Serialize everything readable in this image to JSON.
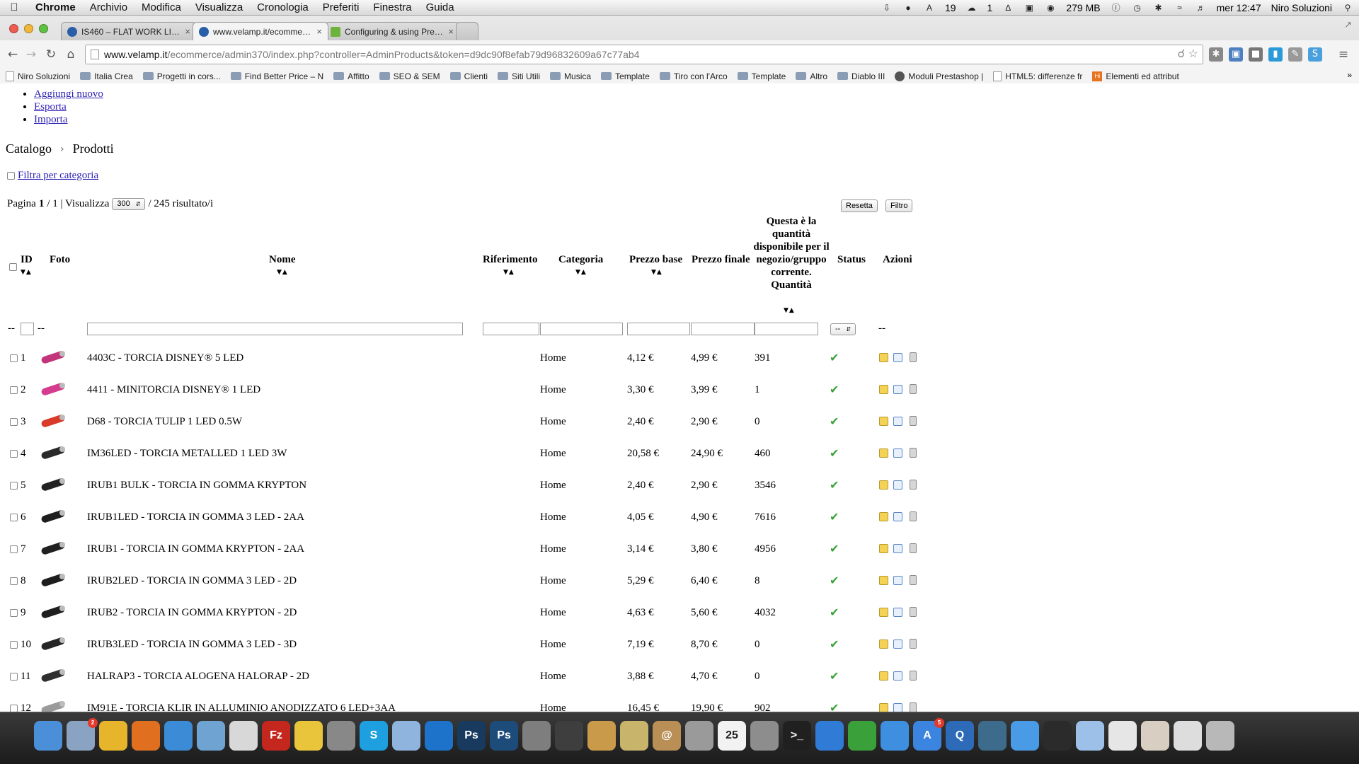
{
  "menubar": {
    "app_name": "Chrome",
    "menus": [
      "Archivio",
      "Modifica",
      "Visualizza",
      "Cronologia",
      "Preferiti",
      "Finestra",
      "Guida"
    ],
    "status": {
      "adobe_count": "19",
      "cloud_count": "1",
      "memory": "279 MB",
      "clock": "mer 12:47",
      "user": "Niro Soluzioni"
    }
  },
  "browser": {
    "tabs": [
      {
        "title": "IS460 – FLAT WORK LIGHT",
        "active": false
      },
      {
        "title": "www.velamp.it/ecommerce",
        "active": true
      },
      {
        "title": "Configuring & using Presta",
        "active": false
      }
    ],
    "url_host": "www.velamp.it",
    "url_path": "/ecommerce/admin370/index.php?controller=AdminProducts&token=d9dc90f8efab79d96832609a67c77ab4",
    "bookmarks": [
      {
        "label": "Niro Soluzioni",
        "icon": "page-icon"
      },
      {
        "label": "Italia Crea",
        "icon": "folder-icon"
      },
      {
        "label": "Progetti in cors...",
        "icon": "folder-icon"
      },
      {
        "label": "Find Better Price – N",
        "icon": "folder-icon"
      },
      {
        "label": "Affitto",
        "icon": "folder-icon"
      },
      {
        "label": "SEO & SEM",
        "icon": "folder-icon"
      },
      {
        "label": "Clienti",
        "icon": "folder-icon"
      },
      {
        "label": "Siti Utili",
        "icon": "folder-icon"
      },
      {
        "label": "Musica",
        "icon": "folder-icon"
      },
      {
        "label": "Template",
        "icon": "folder-icon"
      },
      {
        "label": "Tiro con l'Arco",
        "icon": "folder-icon"
      },
      {
        "label": "Template",
        "icon": "folder-icon"
      },
      {
        "label": "Altro",
        "icon": "folder-icon"
      },
      {
        "label": "Diablo III",
        "icon": "folder-icon"
      },
      {
        "label": "Moduli Prestashop |",
        "icon": "gear-icon"
      },
      {
        "label": "HTML5: differenze fr",
        "icon": "page-icon"
      },
      {
        "label": "Elementi ed attribut",
        "icon": "hm-icon"
      }
    ],
    "bookmarks_more": "»"
  },
  "page": {
    "actions": [
      "Aggiungi nuovo",
      "Esporta",
      "Importa"
    ],
    "breadcrumb": [
      "Catalogo",
      "Prodotti"
    ],
    "filter_category_label": "Filtra per categoria",
    "pagination": {
      "label": "Pagina",
      "current": "1",
      "total": "/ 1 | Visualizza",
      "per_page": "300",
      "results": "/ 245 risultato/i"
    },
    "buttons": {
      "reset": "Resetta",
      "filter": "Filtro"
    },
    "headers": {
      "id": "ID",
      "photo": "Foto",
      "name": "Nome",
      "reference": "Riferimento",
      "category": "Categoria",
      "base_price": "Prezzo base",
      "final_price": "Prezzo finale",
      "quantity": "Questa è la quantità disponibile per il negozio/gruppo corrente. Quantità",
      "status": "Status",
      "actions": "Azioni"
    },
    "filter_row": {
      "dash": "--",
      "status_select": "--"
    },
    "products": [
      {
        "id": "1",
        "name": "4403C - TORCIA DISNEY® 5 LED",
        "category": "Home",
        "base": "4,12 €",
        "final": "4,99 €",
        "qty": "391",
        "thumb_color": "#c2357a"
      },
      {
        "id": "2",
        "name": "4411 - MINITORCIA DISNEY® 1 LED",
        "category": "Home",
        "base": "3,30 €",
        "final": "3,99 €",
        "qty": "1",
        "thumb_color": "#d63c8d"
      },
      {
        "id": "3",
        "name": "D68 - TORCIA TULIP 1 LED 0.5W",
        "category": "Home",
        "base": "2,40 €",
        "final": "2,90 €",
        "qty": "0",
        "thumb_color": "#d93b2b"
      },
      {
        "id": "4",
        "name": "IM36LED - TORCIA METALLED 1 LED 3W",
        "category": "Home",
        "base": "20,58 €",
        "final": "24,90 €",
        "qty": "460",
        "thumb_color": "#2a2a2a"
      },
      {
        "id": "5",
        "name": "IRUB1 BULK - TORCIA IN GOMMA KRYPTON",
        "category": "Home",
        "base": "2,40 €",
        "final": "2,90 €",
        "qty": "3546",
        "thumb_color": "#222222"
      },
      {
        "id": "6",
        "name": "IRUB1LED - TORCIA IN GOMMA 3 LED - 2AA",
        "category": "Home",
        "base": "4,05 €",
        "final": "4,90 €",
        "qty": "7616",
        "thumb_color": "#1e1e1e"
      },
      {
        "id": "7",
        "name": "IRUB1 - TORCIA IN GOMMA KRYPTON - 2AA",
        "category": "Home",
        "base": "3,14 €",
        "final": "3,80 €",
        "qty": "4956",
        "thumb_color": "#202020"
      },
      {
        "id": "8",
        "name": "IRUB2LED - TORCIA IN GOMMA 3 LED - 2D",
        "category": "Home",
        "base": "5,29 €",
        "final": "6,40 €",
        "qty": "8",
        "thumb_color": "#1d1d1d"
      },
      {
        "id": "9",
        "name": "IRUB2 - TORCIA IN GOMMA KRYPTON - 2D",
        "category": "Home",
        "base": "4,63 €",
        "final": "5,60 €",
        "qty": "4032",
        "thumb_color": "#1f1f1f"
      },
      {
        "id": "10",
        "name": "IRUB3LED - TORCIA IN GOMMA 3 LED - 3D",
        "category": "Home",
        "base": "7,19 €",
        "final": "8,70 €",
        "qty": "0",
        "thumb_color": "#262626"
      },
      {
        "id": "11",
        "name": "HALRAP3 - TORCIA ALOGENA HALORAP - 2D",
        "category": "Home",
        "base": "3,88 €",
        "final": "4,70 €",
        "qty": "0",
        "thumb_color": "#303030"
      },
      {
        "id": "12",
        "name": "IM91E - TORCIA KLIR IN ALLUMINIO ANODIZZATO 6 LED+3AA",
        "category": "Home",
        "base": "16,45 €",
        "final": "19,90 €",
        "qty": "902",
        "thumb_color": "#9a9a9a"
      }
    ]
  },
  "dock": [
    {
      "name": "finder-icon",
      "label": "",
      "color": "#4a8fd8"
    },
    {
      "name": "mail-icon",
      "label": "",
      "color": "#8aa3c2",
      "badge": "2"
    },
    {
      "name": "chrome-icon",
      "label": "",
      "color": "#e7b52c"
    },
    {
      "name": "firefox-icon",
      "label": "",
      "color": "#e0701f"
    },
    {
      "name": "safari-icon",
      "label": "",
      "color": "#3b8bd6"
    },
    {
      "name": "remote-desktop-icon",
      "label": "",
      "color": "#6ea3d2"
    },
    {
      "name": "textedit-icon",
      "label": "",
      "color": "#d8d8d8"
    },
    {
      "name": "filezilla-icon",
      "label": "Fz",
      "color": "#c3271d"
    },
    {
      "name": "cyberduck-icon",
      "label": "",
      "color": "#e8c53a"
    },
    {
      "name": "satellite-icon",
      "label": "",
      "color": "#888888"
    },
    {
      "name": "skype-icon",
      "label": "S",
      "color": "#1ea0e0"
    },
    {
      "name": "virtualbox-icon",
      "label": "",
      "color": "#8fb5de"
    },
    {
      "name": "teamviewer-icon",
      "label": "",
      "color": "#1d73c9"
    },
    {
      "name": "photoshop-icon",
      "label": "Ps",
      "color": "#173a5e"
    },
    {
      "name": "photoshop-icon-2",
      "label": "Ps",
      "color": "#1e4c7a"
    },
    {
      "name": "launchpad-icon",
      "label": "",
      "color": "#7e7e7e"
    },
    {
      "name": "facetime-icon",
      "label": "",
      "color": "#3e3e3e"
    },
    {
      "name": "iphoto-icon",
      "label": "",
      "color": "#c89a4a"
    },
    {
      "name": "imovie-icon",
      "label": "",
      "color": "#c9b46b"
    },
    {
      "name": "contacts-icon",
      "label": "@",
      "color": "#b98f55"
    },
    {
      "name": "calculator-icon",
      "label": "",
      "color": "#9a9a9a"
    },
    {
      "name": "calendar-icon",
      "label": "25",
      "color": "#f2f2f2"
    },
    {
      "name": "system-prefs-icon",
      "label": "",
      "color": "#8d8d8d"
    },
    {
      "name": "terminal-icon",
      "label": ">_",
      "color": "#202020"
    },
    {
      "name": "dropbox-icon",
      "label": "",
      "color": "#2f7bd6"
    },
    {
      "name": "keepassx-icon",
      "label": "",
      "color": "#3aa13a"
    },
    {
      "name": "itunes-icon",
      "label": "",
      "color": "#3f8fe0"
    },
    {
      "name": "app-store-icon",
      "label": "A",
      "color": "#3b84e0",
      "badge": "5"
    },
    {
      "name": "quicktime-icon",
      "label": "Q",
      "color": "#2d6bb8"
    },
    {
      "name": "time-machine-icon",
      "label": "",
      "color": "#3d6b8c"
    },
    {
      "name": "wifi-icon",
      "label": "",
      "color": "#4a9be6"
    },
    {
      "name": "ps-doc-icon",
      "label": "",
      "color": "#2b2b2b"
    },
    {
      "name": "virtualbox-vm-icon",
      "label": "",
      "color": "#9cc0e8"
    },
    {
      "name": "window-thumb-icon",
      "label": "",
      "color": "#e6e6e6"
    },
    {
      "name": "window-thumb-icon-2",
      "label": "",
      "color": "#d8cfc2"
    },
    {
      "name": "window-thumb-icon-3",
      "label": "",
      "color": "#dddddd"
    },
    {
      "name": "trash-icon",
      "label": "",
      "color": "#b8b8b8"
    }
  ]
}
